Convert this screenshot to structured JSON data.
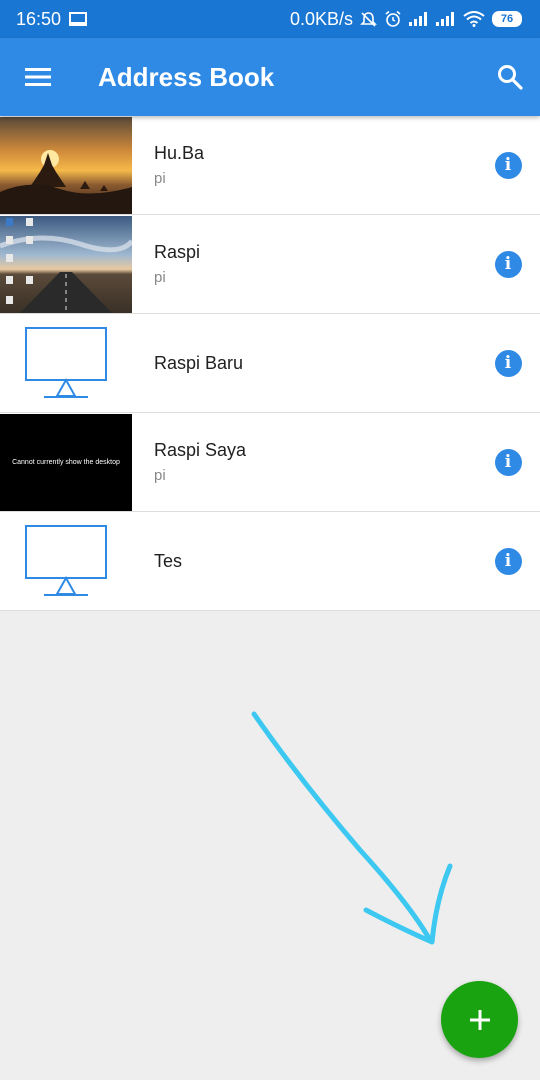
{
  "status_bar": {
    "time": "16:50",
    "network_speed": "0.0KB/s",
    "battery": "76",
    "icons": [
      "screen-cast-icon",
      "mute-icon",
      "alarm-icon",
      "signal-icon",
      "signal-icon",
      "wifi-icon",
      "battery-icon"
    ]
  },
  "app_bar": {
    "title": "Address Book",
    "menu_icon": "hamburger-menu-icon",
    "search_icon": "search-icon",
    "color": "#2f8ae5"
  },
  "entries": [
    {
      "name": "Hu.Ba",
      "user": "pi",
      "thumbnail": "sunset-photo"
    },
    {
      "name": "Raspi",
      "user": "pi",
      "thumbnail": "road-desktop-photo"
    },
    {
      "name": "Raspi Baru",
      "user": "",
      "thumbnail": "monitor-icon"
    },
    {
      "name": "Raspi Saya",
      "user": "pi",
      "thumbnail": "black-screen",
      "thumbnail_text": "Cannot currently show the desktop"
    },
    {
      "name": "Tes",
      "user": "",
      "thumbnail": "monitor-icon"
    }
  ],
  "fab": {
    "icon": "plus-icon",
    "color": "#1aa310"
  },
  "annotation": {
    "icon": "arrow-annotation",
    "color": "#3cc8f0"
  }
}
